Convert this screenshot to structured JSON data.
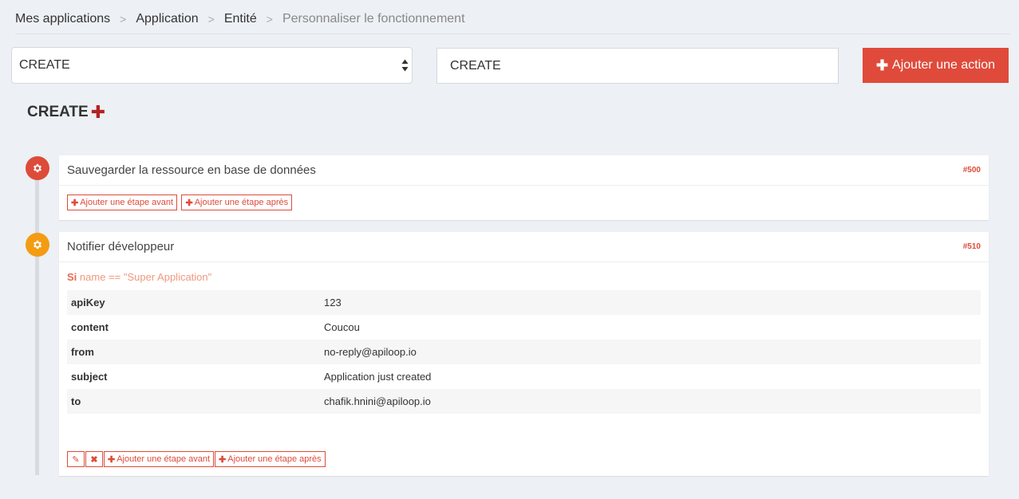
{
  "breadcrumb": {
    "items": [
      "Mes applications",
      "Application",
      "Entité",
      "Personnaliser le fonctionnement"
    ],
    "separator": ">"
  },
  "controls": {
    "select_value": "CREATE",
    "input_value": "CREATE",
    "add_action_label": "Ajouter une action"
  },
  "section": {
    "title": "CREATE"
  },
  "steps": [
    {
      "title": "Sauvegarder la ressource en base de données",
      "id": "#500",
      "icon": "gear-icon",
      "icon_color": "#dd4b39",
      "add_before_label": "Ajouter une étape avant",
      "add_after_label": "Ajouter une étape après"
    },
    {
      "title": "Notifier développeur",
      "id": "#510",
      "icon": "gear-icon",
      "icon_color": "#f39c12",
      "condition_keyword": "Si",
      "condition_expr": "name == \"Super Application\"",
      "params": [
        {
          "key": "apiKey",
          "value": "123"
        },
        {
          "key": "content",
          "value": "Coucou"
        },
        {
          "key": "from",
          "value": "no-reply@apiloop.io"
        },
        {
          "key": "subject",
          "value": "Application just created"
        },
        {
          "key": "to",
          "value": "chafik.hnini@apiloop.io"
        }
      ],
      "add_before_label": "Ajouter une étape avant",
      "add_after_label": "Ajouter une étape après"
    }
  ],
  "colors": {
    "accent": "#dd4b39",
    "warning": "#f39c12",
    "background": "#edf0f4"
  }
}
